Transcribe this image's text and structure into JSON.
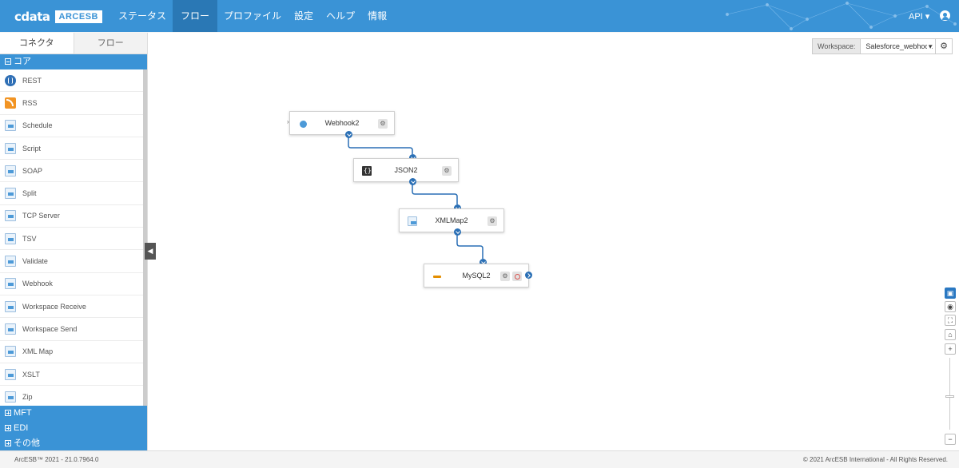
{
  "header": {
    "logo_cdata": "cdata",
    "logo_product": "ARCESB",
    "nav": [
      "ステータス",
      "フロー",
      "プロファイル",
      "設定",
      "ヘルプ",
      "情報"
    ],
    "nav_active": "フロー",
    "api_label": "API ▾"
  },
  "sidebar": {
    "tabs": [
      "コネクタ",
      "フロー"
    ],
    "groups": {
      "core": "コア",
      "mft": "MFT",
      "edi": "EDI",
      "other": "その他"
    },
    "items": [
      {
        "label": "REST",
        "icon": "rest-icon"
      },
      {
        "label": "RSS",
        "icon": "rss-icon"
      },
      {
        "label": "Schedule",
        "icon": "schedule-icon"
      },
      {
        "label": "Script",
        "icon": "script-icon"
      },
      {
        "label": "SOAP",
        "icon": "soap-icon"
      },
      {
        "label": "Split",
        "icon": "split-icon"
      },
      {
        "label": "TCP Server",
        "icon": "tcp-server-icon"
      },
      {
        "label": "TSV",
        "icon": "tsv-icon"
      },
      {
        "label": "Validate",
        "icon": "validate-icon"
      },
      {
        "label": "Webhook",
        "icon": "webhook-icon"
      },
      {
        "label": "Workspace Receive",
        "icon": "workspace-receive-icon"
      },
      {
        "label": "Workspace Send",
        "icon": "workspace-send-icon"
      },
      {
        "label": "XML Map",
        "icon": "xml-map-icon"
      },
      {
        "label": "XSLT",
        "icon": "xslt-icon"
      },
      {
        "label": "Zip",
        "icon": "zip-icon"
      }
    ]
  },
  "workspace": {
    "label": "Workspace:",
    "value": "Salesforce_webhook"
  },
  "flow": {
    "nodes": [
      {
        "label": "Webhook2",
        "icon": "webhook-icon"
      },
      {
        "label": "JSON2",
        "icon": "json-icon"
      },
      {
        "label": "XMLMap2",
        "icon": "xml-map-icon"
      },
      {
        "label": "MySQL2",
        "icon": "mysql-icon"
      }
    ]
  },
  "colors": {
    "brand": "#3a93d6",
    "nav_active": "#2a78b5",
    "connector": "#2a6fb5"
  },
  "footer": {
    "version": "ArcESB™ 2021 - 21.0.7964.0",
    "copyright": "© 2021 ArcESB International - All Rights Reserved."
  }
}
